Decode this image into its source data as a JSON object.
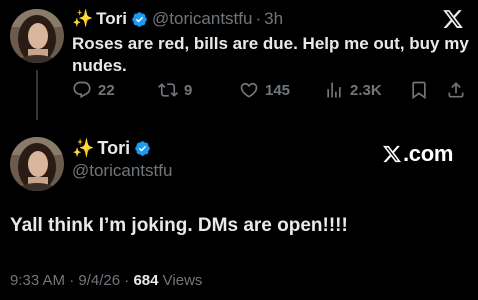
{
  "tweet1": {
    "sparkle": "✨",
    "display_name": "Tori",
    "handle": "@toricantstfu",
    "separator": "·",
    "time": "3h",
    "text": "Roses are red, bills are due. Help me out, buy my nudes.",
    "actions": {
      "replies": "22",
      "reposts": "9",
      "likes": "145",
      "views": "2.3K"
    }
  },
  "tweet2": {
    "sparkle": "✨",
    "display_name": "Tori",
    "handle": "@toricantstfu",
    "brand": ".com",
    "text": "Yall think I’m joking. DMs are open!!!!",
    "footer": {
      "time": "9:33 AM",
      "dot1": "·",
      "date": "9/4/26",
      "dot2": "·",
      "views_count": "684",
      "views_label": "Views"
    }
  },
  "colors": {
    "background": "#000000",
    "text": "#e7e9ea",
    "muted": "#71767b",
    "verified": "#1d9bf0",
    "sparkle": "#f5c400"
  },
  "icons": [
    "x-logo-icon",
    "verified-badge-icon",
    "reply-icon",
    "repost-icon",
    "like-icon",
    "views-icon",
    "bookmark-icon",
    "share-icon"
  ]
}
